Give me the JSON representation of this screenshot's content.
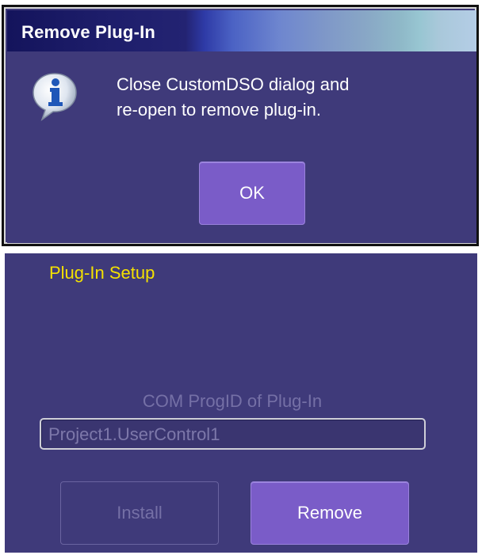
{
  "dialog": {
    "title": "Remove Plug-In",
    "message_line1": "Close CustomDSO dialog and",
    "message_line2": "re-open to remove plug-in.",
    "icon": "info-icon",
    "ok_label": "OK"
  },
  "setup": {
    "title": "Plug-In Setup",
    "progid_label": "COM ProgID of Plug-In",
    "progid_value": "Project1.UserControl1",
    "install_label": "Install",
    "remove_label": "Remove"
  },
  "colors": {
    "panel_bg": "#3f3a7a",
    "button_bg": "#7a5cc8",
    "setup_title": "#f4e100",
    "disabled_text": "#7570a6"
  }
}
